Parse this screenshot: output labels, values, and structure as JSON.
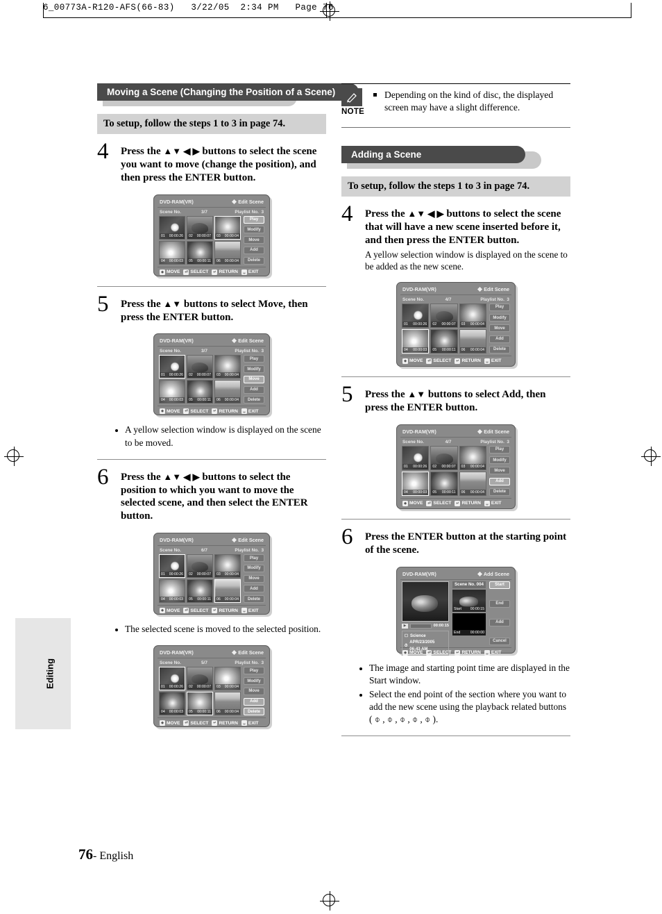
{
  "print_header": "6_00773A-R120-AFS(66-83)   3/22/05  2:34 PM   Page 76",
  "footer": {
    "page": "76",
    "language": "- English"
  },
  "side_tab": {
    "label": "Editing"
  },
  "left_column": {
    "section_title": "Moving a Scene (Changing the Position of a Scene)",
    "setup_bar": "To setup, follow the steps 1 to 3 in page 74.",
    "steps": [
      {
        "num": "4",
        "text_a": "Press the ",
        "arrows": "▲▼ ◀ ▶",
        "text_b": " buttons to select the scene you want to move (change the position), and then press the ENTER button."
      },
      {
        "num": "5",
        "text_a": "Press the ",
        "arrows": "▲▼",
        "text_b": " buttons to select Move, then press the ENTER button."
      },
      {
        "num": "6",
        "text_a": "Press the ",
        "arrows": "▲▼ ◀ ▶",
        "text_b": " buttons to select the position to which you want to move the selected scene, and then select the ENTER button."
      }
    ],
    "note_after_step5": "A yellow selection window is displayed on the scene to be moved.",
    "note_after_step6": "The selected scene is moved to the selected position."
  },
  "right_column": {
    "note": {
      "label": "NOTE",
      "icon": "pencil-icon",
      "text": "Depending on the kind of disc, the displayed screen may have a slight difference."
    },
    "section_title": "Adding a Scene",
    "setup_bar": "To setup, follow the steps 1 to 3 in page 74.",
    "steps": [
      {
        "num": "4",
        "text_a": "Press the ",
        "arrows": "▲▼ ◀ ▶",
        "text_b": " buttons to select the scene that will have a new scene inserted before it, and then press the ENTER button.",
        "sub": "A yellow selection window is displayed on the scene to be added as the new scene."
      },
      {
        "num": "5",
        "text_a": "Press the ",
        "arrows": "▲▼",
        "text_b": " buttons to select Add, then press the ENTER button.",
        "sub": ""
      },
      {
        "num": "6",
        "text_a": "",
        "arrows": "",
        "text_b": "Press the ENTER button at the starting point of the scene.",
        "sub": ""
      }
    ],
    "bullets": [
      "The image and starting point time are displayed in the Start window.",
      "Select the end point of the section where you want to add the new scene using the playback related buttons ( ⌽ , ⌽ , ⌽ , ⌽ , ⌽ )."
    ]
  },
  "osd_common": {
    "disc_label": "DVD-RAM(VR)",
    "title_edit": "Edit Scene",
    "title_add": "Add Scene",
    "scene_no_label": "Scene No.",
    "playlist_label": "Playlist No.",
    "playlist_value": "3",
    "buttons": [
      "Play",
      "Modify",
      "Move",
      "Add",
      "Delete"
    ],
    "footer_items": [
      {
        "key": "◆",
        "label": "MOVE"
      },
      {
        "key": "⏎",
        "label": "SELECT"
      },
      {
        "key": "↵",
        "label": "RETURN"
      },
      {
        "key": "␣",
        "label": "EXIT"
      }
    ],
    "thumbs": [
      {
        "no": "01",
        "time": "00:00:26",
        "pic": "p-leaf"
      },
      {
        "no": "02",
        "time": "00:00:07",
        "pic": "p-dolph"
      },
      {
        "no": "03",
        "time": "00:00:04",
        "pic": "p-flwr1"
      },
      {
        "no": "04",
        "time": "00:00:03",
        "pic": "p-flwr2"
      },
      {
        "no": "05",
        "time": "00:00:11",
        "pic": "p-flwr3"
      },
      {
        "no": "06",
        "time": "00:00:04",
        "pic": "p-field"
      }
    ]
  },
  "osd_screens": {
    "left_step4": {
      "scene_no": "3/7",
      "selected_index": 2,
      "highlight": ""
    },
    "left_step5": {
      "scene_no": "3/7",
      "selected_index": 2,
      "highlight": "Move"
    },
    "left_step6": {
      "scene_no": "6/7",
      "selected_index": 5,
      "highlight": ""
    },
    "left_result": {
      "scene_no": "5/7",
      "selected_index": 4,
      "highlight": ""
    },
    "right_step4": {
      "scene_no": "4/7",
      "selected_index": 3,
      "highlight": ""
    },
    "right_step5": {
      "scene_no": "4/7",
      "selected_index": 3,
      "highlight": "Add"
    }
  },
  "add_scene_screen": {
    "disc_label": "DVD-RAM(VR)",
    "title": "Add Scene",
    "scene_no": "Scene No. 004",
    "preview_time": "00:00:15",
    "info_title": "Science",
    "info_date": "APR/23/2005 06:43 AM",
    "start_label": "Start",
    "start_time": "00:00:15",
    "end_label": "End",
    "end_time": "00:00:00",
    "buttons": [
      "Start",
      "End",
      "Add",
      "Cancel"
    ],
    "highlight": "Start"
  }
}
